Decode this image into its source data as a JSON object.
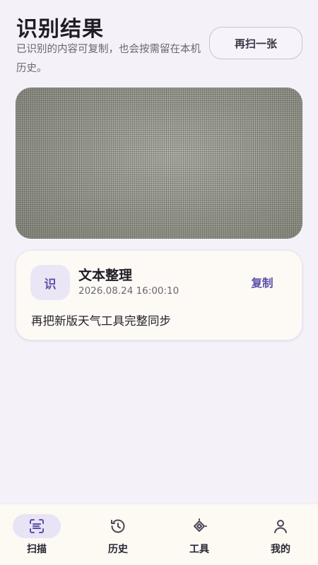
{
  "header": {
    "title": "识别结果",
    "subtitle": "已识别的内容可复制，也会按需留在本机历史。",
    "rescan_label": "再扫一张"
  },
  "result": {
    "badge": "识",
    "title": "文本整理",
    "timestamp": "2026.08.24 16:00:10",
    "copy_label": "复制",
    "text": "再把新版天气工具完整同步"
  },
  "nav": {
    "items": [
      {
        "label": "扫描",
        "icon": "scan-icon",
        "active": true
      },
      {
        "label": "历史",
        "icon": "history-icon",
        "active": false
      },
      {
        "label": "工具",
        "icon": "tools-icon",
        "active": false
      },
      {
        "label": "我的",
        "icon": "profile-icon",
        "active": false
      }
    ]
  },
  "colors": {
    "background": "#f4f1f9",
    "accent": "#5a4fa8",
    "card": "#fdfaf5",
    "active_pill": "#e8e4f6"
  }
}
